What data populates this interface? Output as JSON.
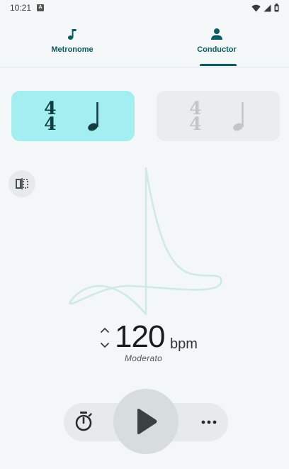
{
  "status_bar": {
    "time": "10:21",
    "badge": "A"
  },
  "tabs": [
    {
      "label": "Metronome",
      "icon": "music-note-icon",
      "selected": false
    },
    {
      "label": "Conductor",
      "icon": "person-icon",
      "selected": true
    }
  ],
  "time_signatures": [
    {
      "numerator": "4",
      "denominator": "4",
      "beat_note": "quarter-note-icon",
      "active": true
    },
    {
      "numerator": "4",
      "denominator": "4",
      "beat_note": "quarter-note-icon",
      "active": false
    }
  ],
  "tempo": {
    "bpm": "120",
    "unit": "bpm",
    "marking": "Moderato"
  },
  "icons": {
    "side_button": "flip-icon",
    "timer": "timer-icon",
    "play": "play-icon",
    "more": "more-horizontal-icon"
  },
  "colors": {
    "accent": "#0d5b62",
    "active_card": "#a2eef0",
    "inactive_card": "#e9eded",
    "background": "#f3f7f7",
    "conductor_path": "#cfe9e7"
  }
}
